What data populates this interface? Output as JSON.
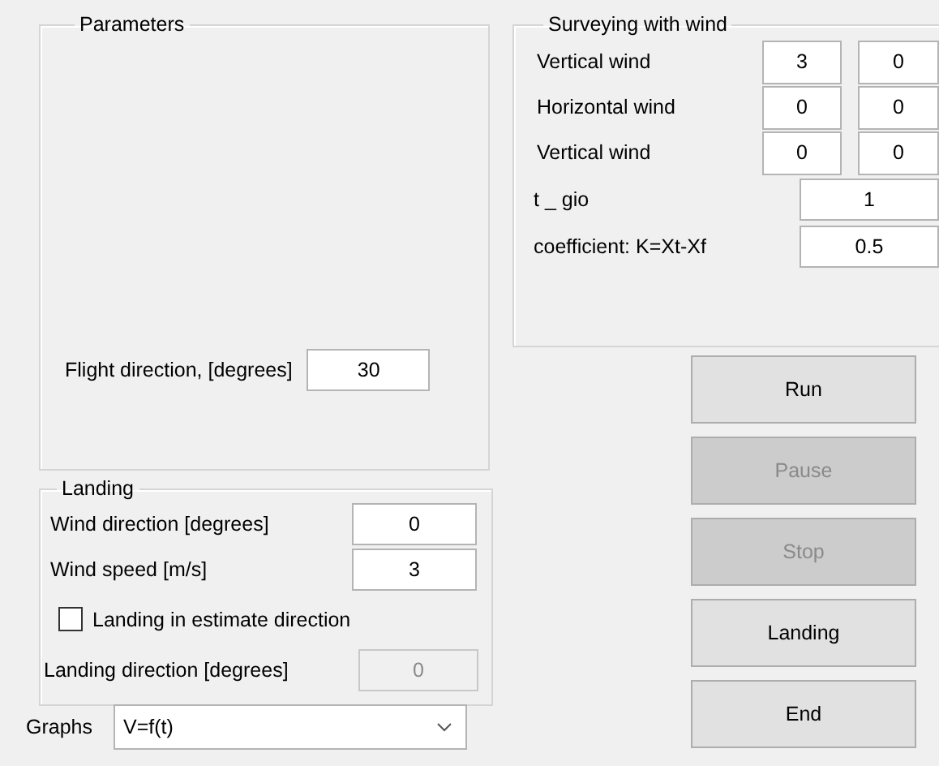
{
  "parameters": {
    "title": "Parameters",
    "flight_direction": {
      "label": "Flight direction, [degrees]",
      "value": "30"
    }
  },
  "surveying": {
    "title": "Surveying with wind",
    "wind_rows": [
      {
        "label": "Vertical wind",
        "values": [
          "3",
          "0"
        ]
      },
      {
        "label": "Horizontal wind",
        "values": [
          "0",
          "0"
        ]
      },
      {
        "label": "Vertical wind",
        "values": [
          "0",
          "0"
        ]
      }
    ],
    "fields": [
      {
        "label": "t _ gio",
        "value": "1"
      },
      {
        "label": "coefficient: K=Xt-Xf",
        "value": "0.5"
      }
    ]
  },
  "landing": {
    "title": "Landing",
    "fields": [
      {
        "label": "Wind direction [degrees]",
        "value": "0"
      },
      {
        "label": "Wind speed [m/s]",
        "value": "3"
      }
    ],
    "estimate": {
      "label": "Landing in estimate direction",
      "checked": false
    },
    "direction": {
      "label": "Landing direction [degrees]",
      "value": "0",
      "disabled": true
    }
  },
  "graphs": {
    "label": "Graphs",
    "value": "V=f(t)"
  },
  "buttons": [
    {
      "label": "Run",
      "disabled": false
    },
    {
      "label": "Pause",
      "disabled": true
    },
    {
      "label": "Stop",
      "disabled": true
    },
    {
      "label": "Landing",
      "disabled": false
    },
    {
      "label": "End",
      "disabled": false
    }
  ]
}
